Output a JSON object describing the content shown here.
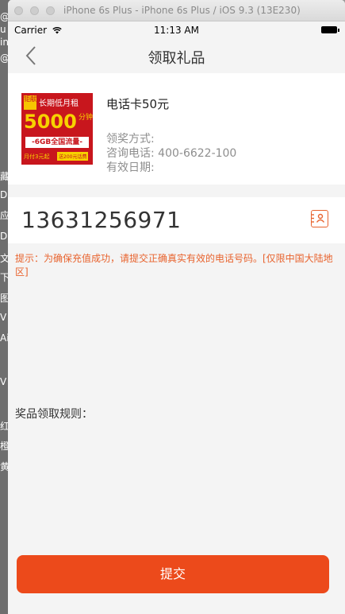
{
  "window": {
    "title": "iPhone 6s Plus - iPhone 6s Plus / iOS 9.3 (13E230)"
  },
  "background_text": [
    "@",
    "u S",
    "in",
    "@",
    "藏",
    "D",
    "应",
    "D",
    "文",
    "下",
    "图",
    "V",
    "Ai",
    "V",
    "红",
    "橙",
    "黄"
  ],
  "status_bar": {
    "carrier": "Carrier",
    "time": "11:13 AM"
  },
  "nav": {
    "title": "领取礼品",
    "back_icon": "chevron-left-icon"
  },
  "prize": {
    "name": "电话卡50元",
    "method_label": "领奖方式:",
    "phone_label": "咨询电话: 400-6622-100",
    "expiry_label": "有效日期:",
    "image": {
      "tag": "钜献",
      "headline": "长期低月租",
      "big_number": "5000",
      "unit": "分钟",
      "band": "-6GB全国流量-",
      "footer_left": "月付3元起",
      "footer_right": "送200元话费"
    }
  },
  "phone_input": {
    "value": "13631256971",
    "contact_icon": "contact-book-icon"
  },
  "hint": "提示：为确保充值成功，请提交正确真实有效的电话号码。[仅限中国大陆地区]",
  "rules_label": "奖品领取规则：",
  "submit_label": "提交",
  "colors": {
    "accent": "#ec4a1b",
    "hint": "#e8632e"
  }
}
